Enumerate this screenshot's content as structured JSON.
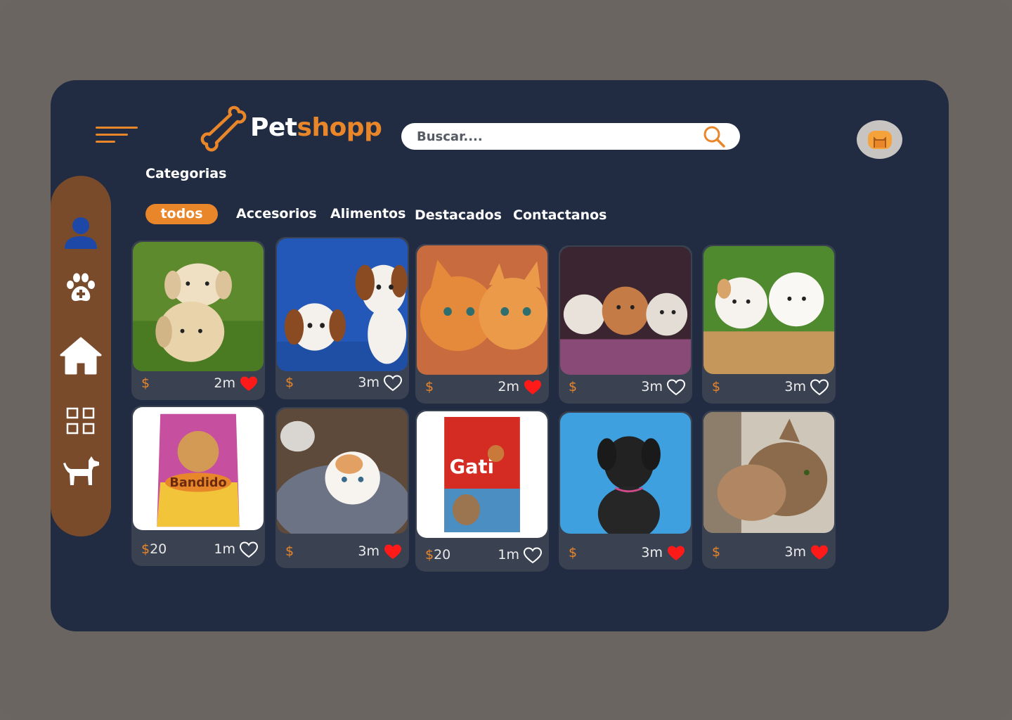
{
  "brand": {
    "name_part1": "Pet",
    "name_part2": "shopp"
  },
  "search": {
    "placeholder": "Buscar...."
  },
  "categories_title": "Categorias",
  "tabs": [
    {
      "label": "todos",
      "active": true
    },
    {
      "label": "Accesorios"
    },
    {
      "label": "Alimentos"
    },
    {
      "label": "Destacados"
    },
    {
      "label": "Contactanos"
    }
  ],
  "sidebar": [
    "user-icon",
    "paw-plus-icon",
    "home-icon",
    "grid-icon",
    "dog-icon"
  ],
  "colors": {
    "accent": "#e9862a",
    "background": "#212c43",
    "sidebar": "#7a4b2b",
    "card": "#3a4252",
    "heart": "#ff1a1a"
  },
  "cards": [
    {
      "price_symbol": "$",
      "price": "",
      "time": "2m",
      "liked": true,
      "image": "two-puppies"
    },
    {
      "price_symbol": "$",
      "price": "",
      "time": "3m",
      "liked": false,
      "image": "cavalier-puppies"
    },
    {
      "price_symbol": "$",
      "price": "",
      "time": "2m",
      "liked": true,
      "image": "orange-kittens"
    },
    {
      "price_symbol": "$",
      "price": "",
      "time": "3m",
      "liked": false,
      "image": "three-kittens"
    },
    {
      "price_symbol": "$",
      "price": "",
      "time": "3m",
      "liked": false,
      "image": "white-puppies"
    },
    {
      "price_symbol": "$",
      "price": "20",
      "time": "1m",
      "liked": false,
      "image": "dog-food-bag"
    },
    {
      "price_symbol": "$",
      "price": "",
      "time": "3m",
      "liked": true,
      "image": "kitten-in-basket"
    },
    {
      "price_symbol": "$",
      "price": "20",
      "time": "1m",
      "liked": false,
      "image": "cat-food-bag"
    },
    {
      "price_symbol": "$",
      "price": "",
      "time": "3m",
      "liked": true,
      "image": "black-puppy"
    },
    {
      "price_symbol": "$",
      "price": "",
      "time": "3m",
      "liked": true,
      "image": "two-cats"
    }
  ]
}
